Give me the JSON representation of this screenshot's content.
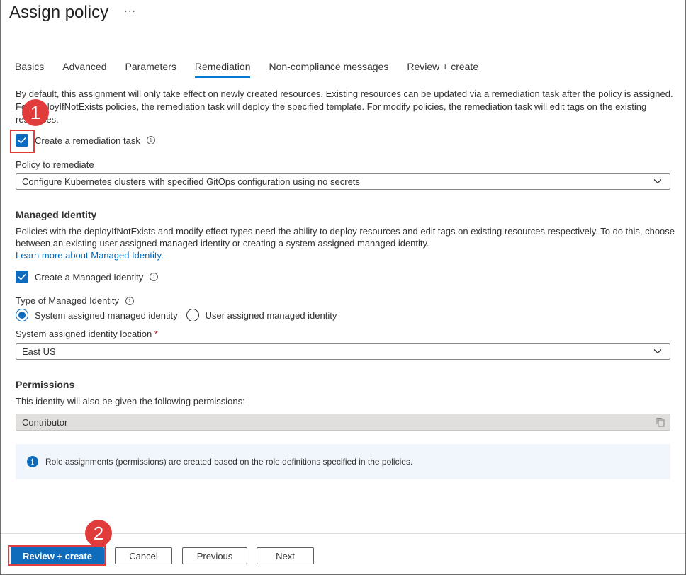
{
  "header": {
    "title": "Assign policy",
    "more_label": "···"
  },
  "tabs": [
    {
      "label": "Basics",
      "active": false
    },
    {
      "label": "Advanced",
      "active": false
    },
    {
      "label": "Parameters",
      "active": false
    },
    {
      "label": "Remediation",
      "active": true
    },
    {
      "label": "Non-compliance messages",
      "active": false
    },
    {
      "label": "Review + create",
      "active": false
    }
  ],
  "remediation": {
    "intro": "By default, this assignment will only take effect on newly created resources. Existing resources can be updated via a remediation task after the policy is assigned. For deployIfNotExists policies, the remediation task will deploy the specified template. For modify policies, the remediation task will edit tags on the existing resources.",
    "create_task_label": "Create a remediation task",
    "create_task_checked": true,
    "policy_label": "Policy to remediate",
    "policy_value": "Configure Kubernetes clusters with specified GitOps configuration using no secrets"
  },
  "managed_identity": {
    "title": "Managed Identity",
    "description": "Policies with the deployIfNotExists and modify effect types need the ability to deploy resources and edit tags on existing resources respectively. To do this, choose between an existing user assigned managed identity or creating a system assigned managed identity.",
    "learn_more": "Learn more about Managed Identity.",
    "create_label": "Create a Managed Identity",
    "create_checked": true,
    "type_label": "Type of Managed Identity",
    "options": [
      {
        "label": "System assigned managed identity",
        "selected": true
      },
      {
        "label": "User assigned managed identity",
        "selected": false
      }
    ],
    "location_label": "System assigned identity location",
    "required_mark": "*",
    "location_value": "East US"
  },
  "permissions": {
    "title": "Permissions",
    "description": "This identity will also be given the following permissions:",
    "role": "Contributor",
    "info": "Role assignments (permissions) are created based on the role definitions specified in the policies."
  },
  "footer": {
    "review_create": "Review + create",
    "cancel": "Cancel",
    "previous": "Previous",
    "next": "Next"
  },
  "annotations": {
    "step1": "1",
    "step2": "2"
  },
  "colors": {
    "accent": "#0f6cbd",
    "annotation": "#e03c3c"
  }
}
